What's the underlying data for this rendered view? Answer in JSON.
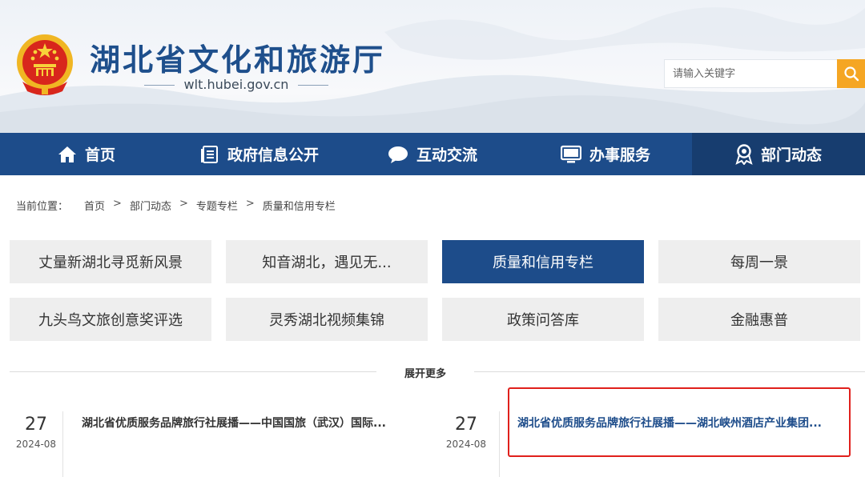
{
  "header": {
    "site_title": "湖北省文化和旅游厅",
    "domain": "wlt.hubei.gov.cn",
    "search": {
      "placeholder": "请输入关键字"
    }
  },
  "nav": [
    {
      "label": "首页",
      "icon": "home-icon"
    },
    {
      "label": "政府信息公开",
      "icon": "document-icon"
    },
    {
      "label": "互动交流",
      "icon": "chat-icon"
    },
    {
      "label": "办事服务",
      "icon": "monitor-icon"
    },
    {
      "label": "部门动态",
      "icon": "award-icon",
      "active": true
    }
  ],
  "breadcrumb": {
    "lead": "当前位置：",
    "items": [
      "首页",
      "部门动态",
      "专题专栏",
      "质量和信用专栏"
    ],
    "separator": ">"
  },
  "tiles": [
    {
      "label": "丈量新湖北寻觅新风景"
    },
    {
      "label": "知音湖北，遇见无..."
    },
    {
      "label": "质量和信用专栏",
      "active": true
    },
    {
      "label": "每周一景"
    },
    {
      "label": "九头鸟文旅创意奖评选"
    },
    {
      "label": "灵秀湖北视频集锦"
    },
    {
      "label": "政策问答库"
    },
    {
      "label": "金融惠普"
    }
  ],
  "more_label": "展开更多",
  "news": [
    {
      "day": "27",
      "year_month": "2024-08",
      "title": "湖北省优质服务品牌旅行社展播——中国国旅（武汉）国际..."
    },
    {
      "day": "27",
      "year_month": "2024-08",
      "title": "湖北省优质服务品牌旅行社展播——湖北峡州酒店产业集团..."
    }
  ],
  "colors": {
    "nav_bg": "#1d4c8a",
    "accent": "#f5a623",
    "title": "#1e4f8c",
    "highlight_border": "#e0201c"
  }
}
